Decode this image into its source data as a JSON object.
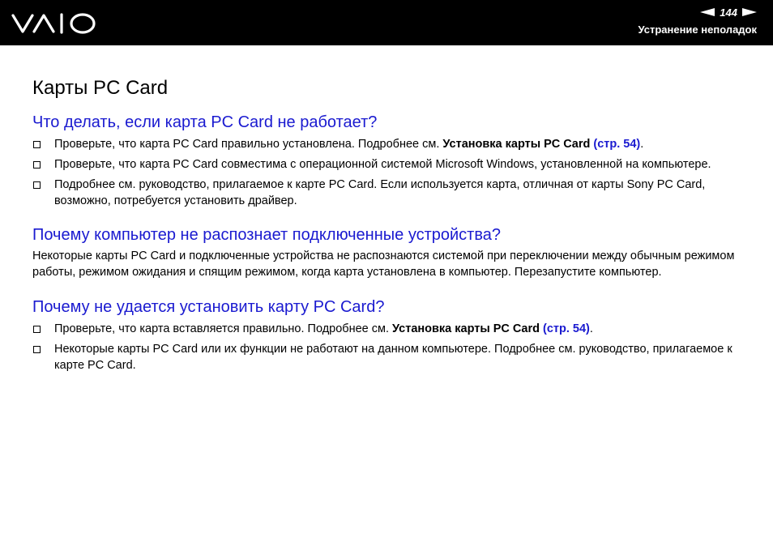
{
  "header": {
    "logo_text": "VAIO",
    "page_number": "144",
    "section": "Устранение неполадок"
  },
  "title": "Карты PC Card",
  "sections": [
    {
      "heading": "Что делать, если карта PC Card не работает?",
      "items": [
        {
          "text": "Проверьте, что карта PC Card правильно установлена. Подробнее см. ",
          "bold": "Установка карты PC Card",
          "link": "(стр. 54)",
          "tail": "."
        },
        {
          "text": "Проверьте, что карта PC Card совместима с операционной системой Microsoft Windows, установленной на компьютере."
        },
        {
          "text": "Подробнее см. руководство, прилагаемое к карте PC Card. Если используется карта, отличная от карты Sony PC Card, возможно, потребуется установить драйвер."
        }
      ]
    },
    {
      "heading": "Почему компьютер не распознает подключенные устройства?",
      "paragraph": "Некоторые карты PC Card и подключенные устройства не распознаются системой при переключении между обычным режимом работы, режимом ожидания и спящим режимом, когда карта установлена в компьютер. Перезапустите компьютер."
    },
    {
      "heading": "Почему не удается установить карту PC Card?",
      "items": [
        {
          "text": "Проверьте, что карта вставляется правильно. Подробнее см. ",
          "bold": "Установка карты PC Card",
          "link": "(стр. 54)",
          "tail": "."
        },
        {
          "text": "Некоторые карты PC Card или их функции не работают на данном компьютере. Подробнее см. руководство, прилагаемое к карте PC Card."
        }
      ]
    }
  ]
}
